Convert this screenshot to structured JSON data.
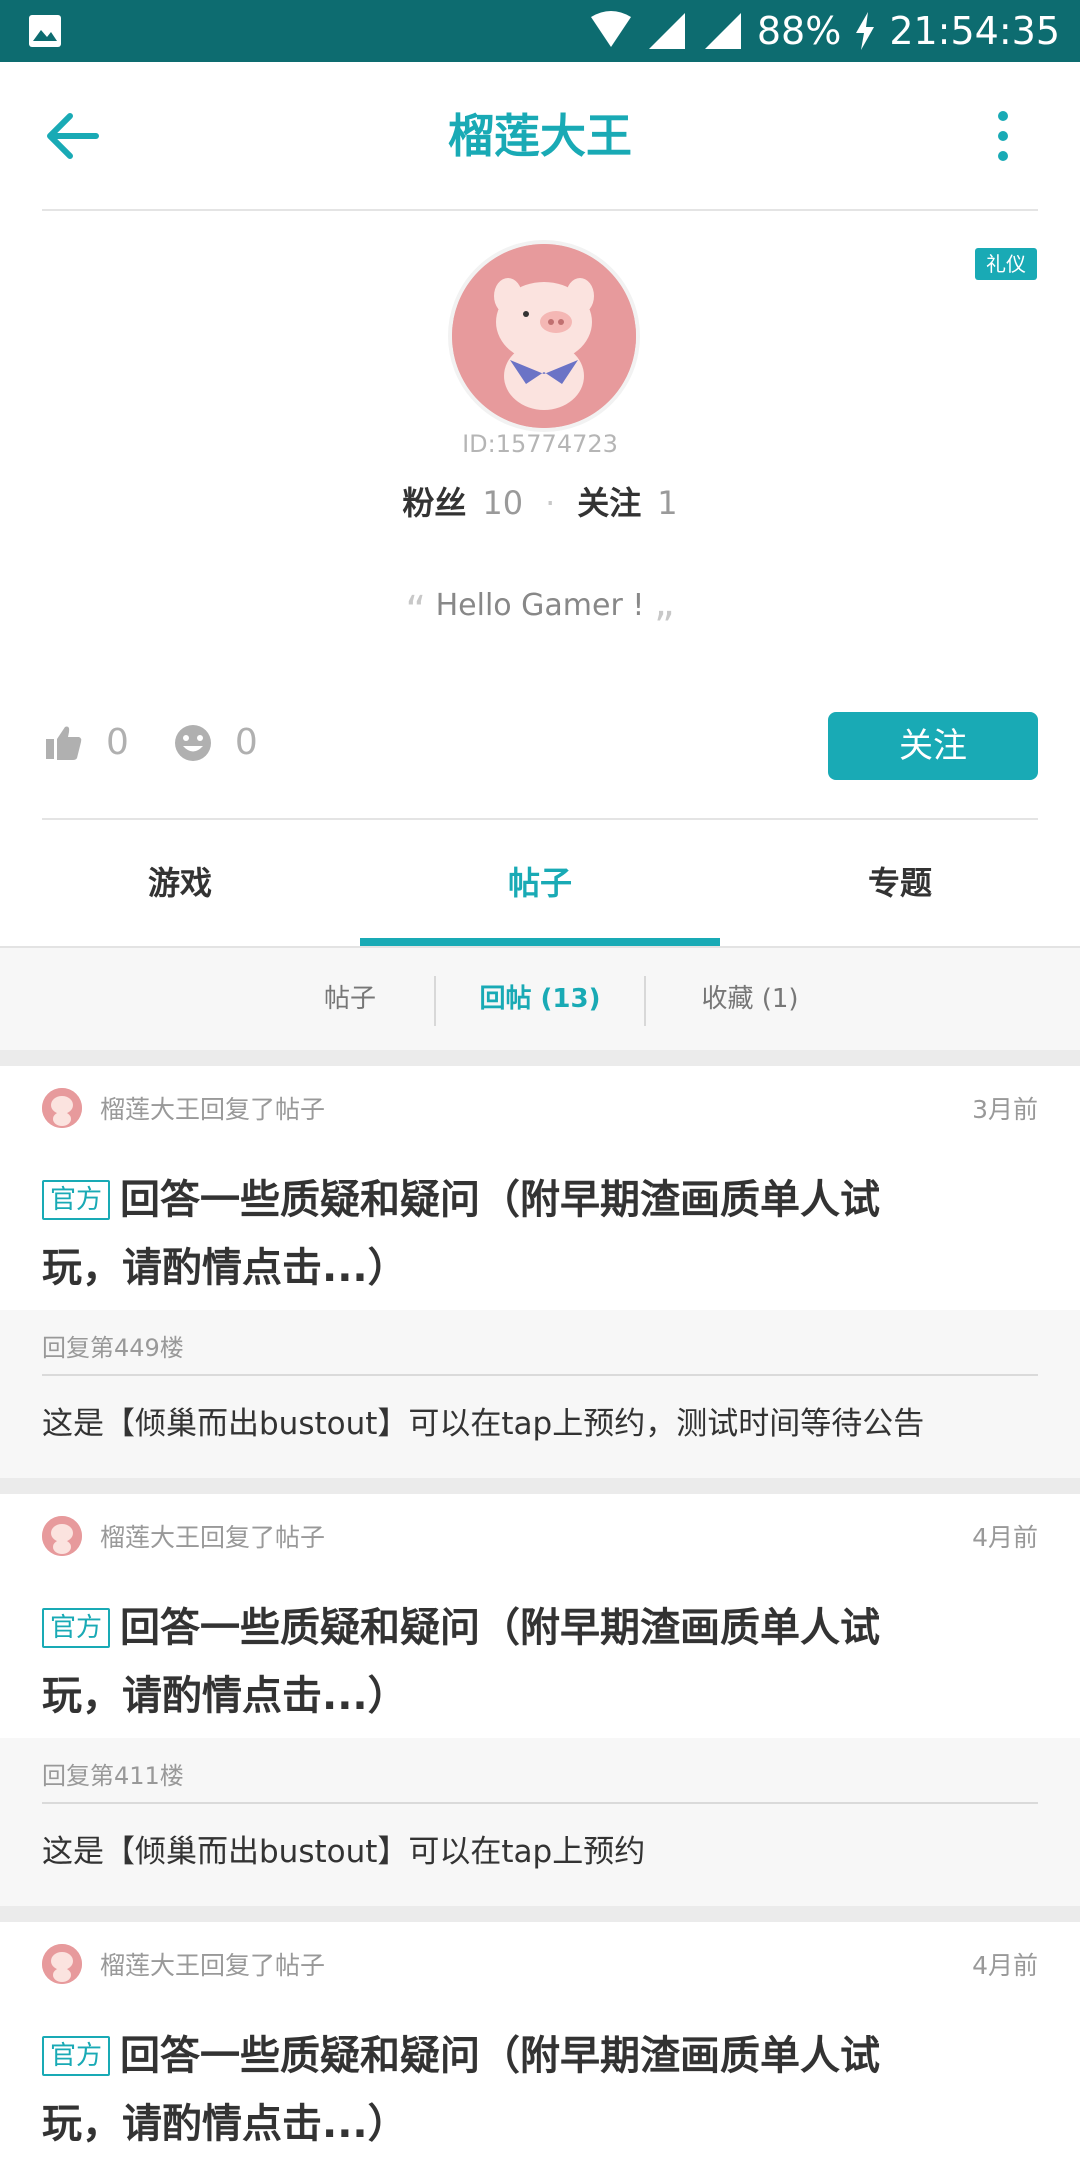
{
  "status_bar": {
    "battery": "88%",
    "time": "21:54:35"
  },
  "header": {
    "title": "榴莲大王"
  },
  "profile": {
    "badge": "礼仪",
    "user_id": "ID:15774723",
    "fans_label": "粉丝",
    "fans_count": "10",
    "following_label": "关注",
    "following_count": "1",
    "bio": "Hello Gamer !",
    "likes": "0",
    "smiles": "0",
    "follow_button": "关注"
  },
  "tabs": [
    "游戏",
    "帖子",
    "专题"
  ],
  "active_tab": "帖子",
  "subtabs": [
    "帖子",
    "回帖 (13)",
    "收藏 (1)"
  ],
  "active_subtab": "回帖 (13)",
  "posts": [
    {
      "action": "榴莲大王回复了帖子",
      "time": "3月前",
      "tag": "官方",
      "title": "回答一些质疑和疑问（附早期渣画质单人试玩，请酌情点击...）",
      "floor": "回复第449楼",
      "reply": "这是【倾巢而出bustout】可以在tap上预约，测试时间等待公告"
    },
    {
      "action": "榴莲大王回复了帖子",
      "time": "4月前",
      "tag": "官方",
      "title": "回答一些质疑和疑问（附早期渣画质单人试玩，请酌情点击...）",
      "floor": "回复第411楼",
      "reply": "这是【倾巢而出bustout】可以在tap上预约"
    },
    {
      "action": "榴莲大王回复了帖子",
      "time": "4月前",
      "tag": "官方",
      "title": "回答一些质疑和疑问（附早期渣画质单人试玩，请酌情点击...）"
    }
  ],
  "colors": {
    "accent": "#19aab5",
    "status_bar": "#0d6c70",
    "avatar_bg": "#e79a9c"
  }
}
